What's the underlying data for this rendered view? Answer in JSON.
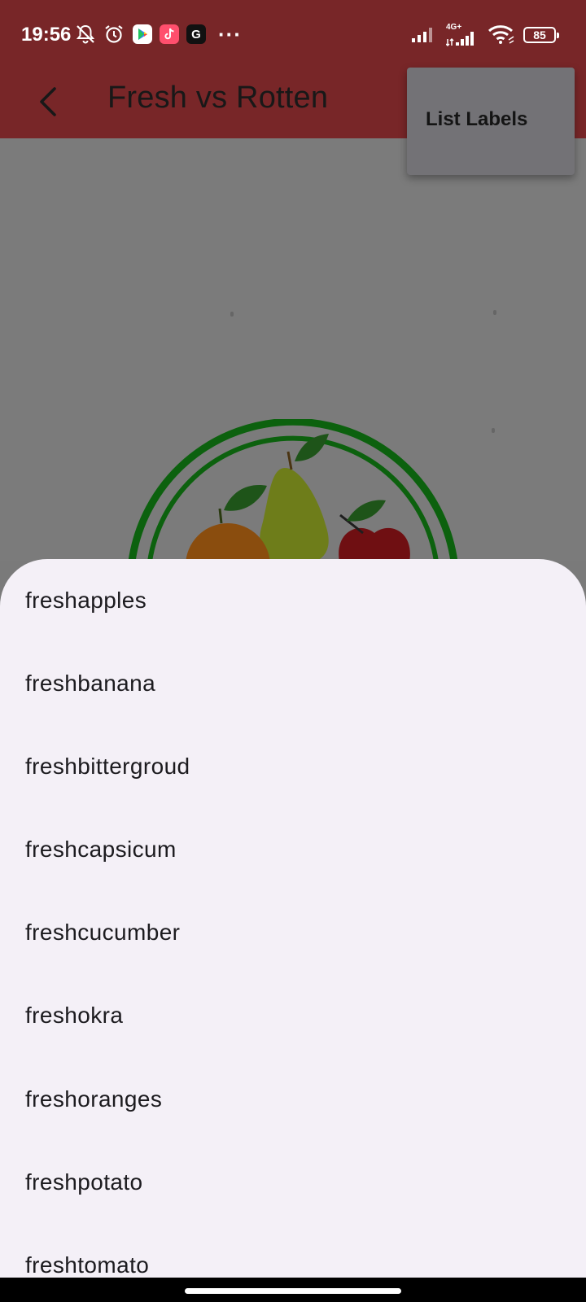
{
  "status_bar": {
    "time": "19:56",
    "icons": [
      "bell-off-icon",
      "alarm-icon",
      "play-store-icon",
      "tiktok-icon",
      "google-icon",
      "more-dots-icon",
      "signal-icon",
      "signal-4g-icon",
      "wifi-icon",
      "battery-icon"
    ],
    "network_label": "4G+",
    "more": "···",
    "battery": "85",
    "google_letter": "G"
  },
  "app_bar": {
    "title": "Fresh vs Rotten",
    "back_icon": "chevron-left-icon",
    "color": "#782628"
  },
  "popup_menu": {
    "items": [
      "List Labels"
    ]
  },
  "labels": [
    "freshapples",
    "freshbanana",
    "freshbittergroud",
    "freshcapsicum",
    "freshcucumber",
    "freshokra",
    "freshoranges",
    "freshpotato",
    "freshtomato"
  ],
  "colors": {
    "sheet_background": "#f4f0f7",
    "scrim": "#7b7b7b"
  }
}
